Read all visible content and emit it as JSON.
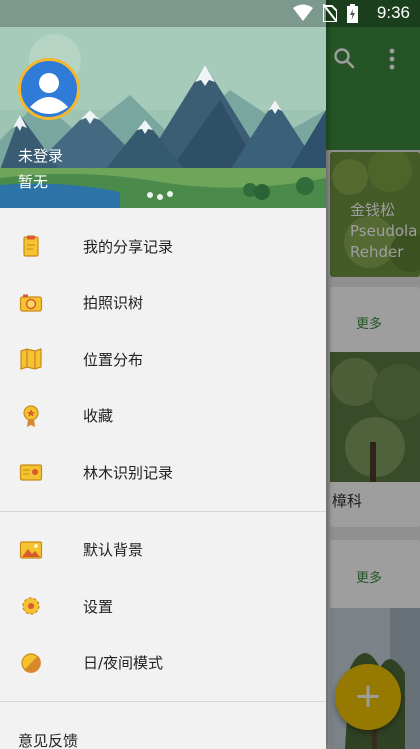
{
  "status_bar": {
    "time": "9:36"
  },
  "user": {
    "name": "未登录",
    "subtitle": "暂无"
  },
  "menu": {
    "group1": [
      {
        "label": "我的分享记录",
        "icon": "clipboard-icon"
      },
      {
        "label": "拍照识树",
        "icon": "camera-icon"
      },
      {
        "label": "位置分布",
        "icon": "map-icon"
      },
      {
        "label": "收藏",
        "icon": "medal-icon"
      },
      {
        "label": "林木识别记录",
        "icon": "id-card-icon"
      }
    ],
    "group2": [
      {
        "label": "默认背景",
        "icon": "image-icon"
      },
      {
        "label": "设置",
        "icon": "gear-icon"
      },
      {
        "label": "日/夜间模式",
        "icon": "moon-icon"
      }
    ],
    "feedback": {
      "label": "意见反馈"
    }
  },
  "background": {
    "card1_title": "金钱松",
    "card1_latin_1": "Pseudola",
    "card1_latin_2": "Rehder",
    "more_label_1": "更多",
    "more_label_2": "更多",
    "family_label": "樟科",
    "fab_label": "+"
  },
  "colors": {
    "accent": "#f2c300",
    "toolbar": "#3c8a3f",
    "avatar_ring": "#f3b82c",
    "avatar": "#2f7bd8"
  }
}
